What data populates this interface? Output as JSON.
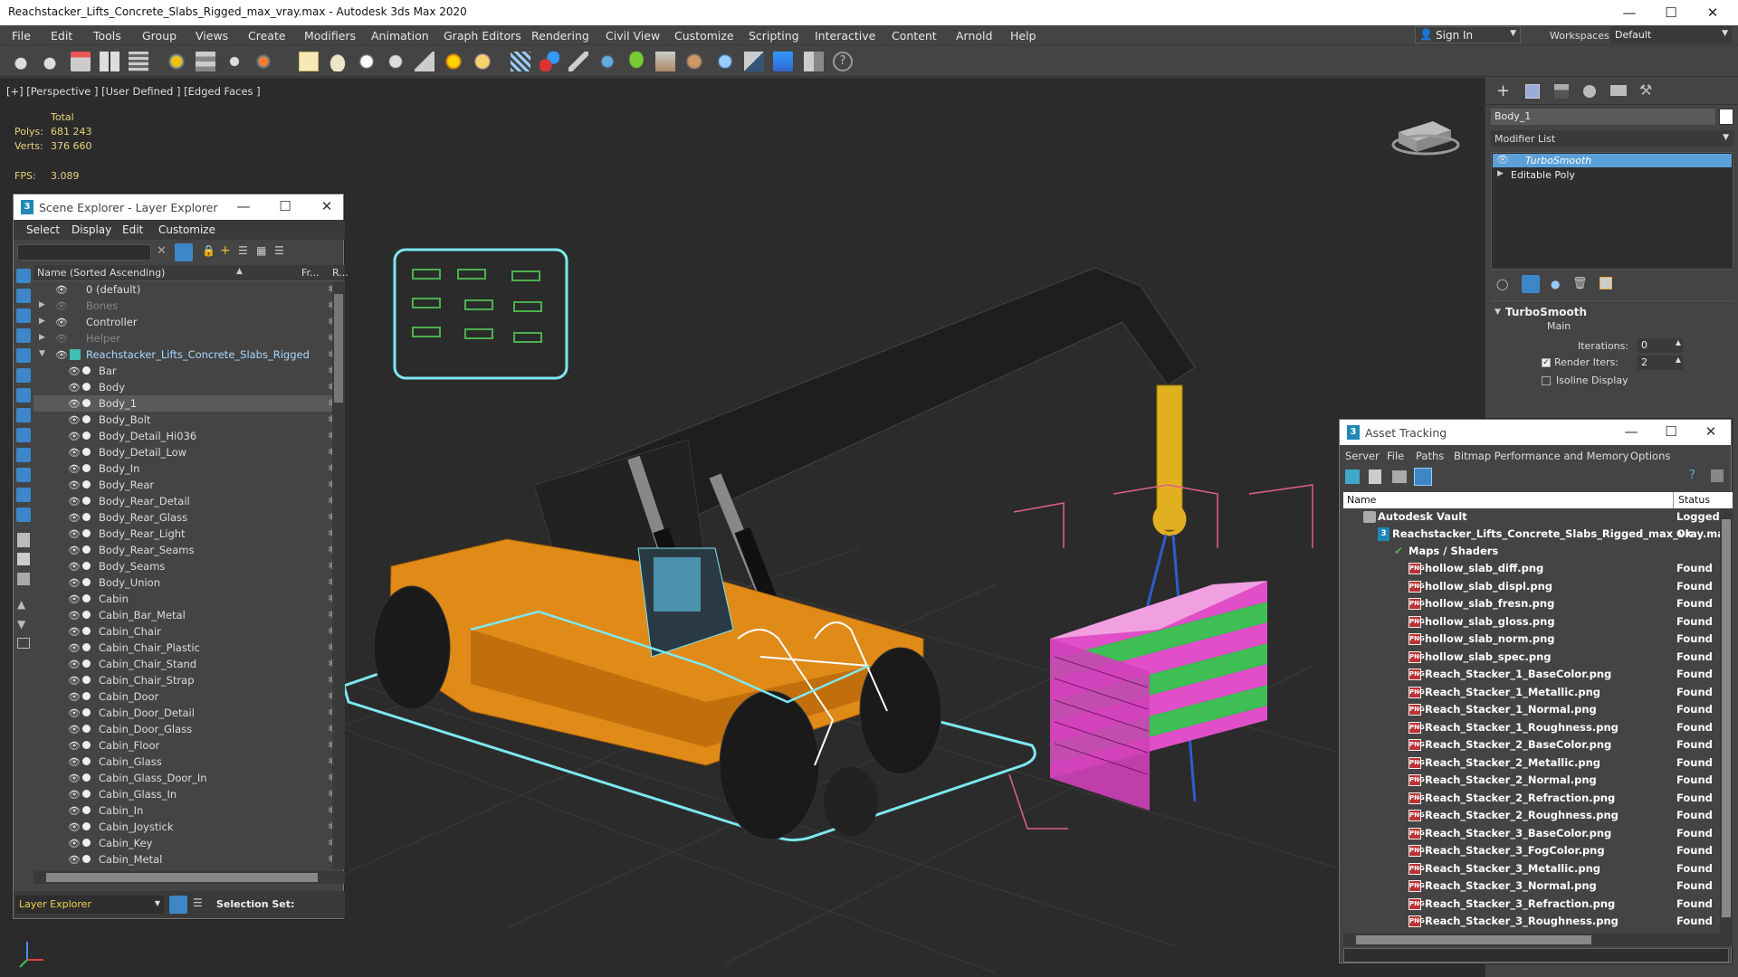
{
  "app": {
    "title": "Reachstacker_Lifts_Concrete_Slabs_Rigged_max_vray.max - Autodesk 3ds Max 2020"
  },
  "menu": [
    "File",
    "Edit",
    "Tools",
    "Group",
    "Views",
    "Create",
    "Modifiers",
    "Animation",
    "Graph Editors",
    "Rendering",
    "Civil View",
    "Customize",
    "Scripting",
    "Interactive",
    "Content",
    "Arnold",
    "Help"
  ],
  "signin": {
    "label": "Sign In",
    "workspaces_label": "Workspaces:",
    "workspace": "Default"
  },
  "viewport": {
    "label": "[+] [Perspective ] [User Defined ] [Edged Faces ]",
    "stats": {
      "total_label": "Total",
      "polys_label": "Polys:",
      "polys": "681 243",
      "verts_label": "Verts:",
      "verts": "376 660",
      "fps_label": "FPS:",
      "fps": "3.089"
    }
  },
  "command_panel": {
    "object_name": "Body_1",
    "modifier_list": "Modifier List",
    "stack": [
      "TurboSmooth",
      "Editable Poly"
    ],
    "rollout_title": "TurboSmooth",
    "main_label": "Main",
    "iterations_label": "Iterations:",
    "iterations": "0",
    "render_iters_label": "Render Iters:",
    "render_iters": "2",
    "isoline_label": "Isoline Display"
  },
  "scene_explorer": {
    "title": "Scene Explorer - Layer Explorer",
    "menu": [
      "Select",
      "Display",
      "Edit",
      "Customize"
    ],
    "col_name": "Name (Sorted Ascending)",
    "col_fr": "Fr...",
    "col_r": "R...",
    "layers": [
      "0 (default)",
      "Bones",
      "Controller",
      "Helper",
      "Reachstacker_Lifts_Concrete_Slabs_Rigged"
    ],
    "objects": [
      "Bar",
      "Body",
      "Body_1",
      "Body_Bolt",
      "Body_Detail_Hi036",
      "Body_Detail_Low",
      "Body_In",
      "Body_Rear",
      "Body_Rear_Detail",
      "Body_Rear_Glass",
      "Body_Rear_Light",
      "Body_Rear_Seams",
      "Body_Seams",
      "Body_Union",
      "Cabin",
      "Cabin_Bar_Metal",
      "Cabin_Chair",
      "Cabin_Chair_Plastic",
      "Cabin_Chair_Stand",
      "Cabin_Chair_Strap",
      "Cabin_Door",
      "Cabin_Door_Detail",
      "Cabin_Door_Glass",
      "Cabin_Floor",
      "Cabin_Glass",
      "Cabin_Glass_Door_In",
      "Cabin_Glass_In",
      "Cabin_In",
      "Cabin_Joystick",
      "Cabin_Key",
      "Cabin_Metal"
    ],
    "footer_mode": "Layer Explorer",
    "selection_set_label": "Selection Set:"
  },
  "asset_tracking": {
    "title": "Asset Tracking",
    "menu": [
      "Server",
      "File",
      "Paths",
      "Bitmap Performance and Memory",
      "Options"
    ],
    "col_name": "Name",
    "col_status": "Status",
    "vault": {
      "name": "Autodesk Vault",
      "status": "Logged"
    },
    "file": {
      "name": "Reachstacker_Lifts_Concrete_Slabs_Rigged_max_vray.max",
      "status": "Ok"
    },
    "maps_label": "Maps / Shaders",
    "maps": [
      {
        "name": "hollow_slab_diff.png",
        "status": "Found"
      },
      {
        "name": "hollow_slab_displ.png",
        "status": "Found"
      },
      {
        "name": "hollow_slab_fresn.png",
        "status": "Found"
      },
      {
        "name": "hollow_slab_gloss.png",
        "status": "Found"
      },
      {
        "name": "hollow_slab_norm.png",
        "status": "Found"
      },
      {
        "name": "hollow_slab_spec.png",
        "status": "Found"
      },
      {
        "name": "Reach_Stacker_1_BaseColor.png",
        "status": "Found"
      },
      {
        "name": "Reach_Stacker_1_Metallic.png",
        "status": "Found"
      },
      {
        "name": "Reach_Stacker_1_Normal.png",
        "status": "Found"
      },
      {
        "name": "Reach_Stacker_1_Roughness.png",
        "status": "Found"
      },
      {
        "name": "Reach_Stacker_2_BaseColor.png",
        "status": "Found"
      },
      {
        "name": "Reach_Stacker_2_Metallic.png",
        "status": "Found"
      },
      {
        "name": "Reach_Stacker_2_Normal.png",
        "status": "Found"
      },
      {
        "name": "Reach_Stacker_2_Refraction.png",
        "status": "Found"
      },
      {
        "name": "Reach_Stacker_2_Roughness.png",
        "status": "Found"
      },
      {
        "name": "Reach_Stacker_3_BaseColor.png",
        "status": "Found"
      },
      {
        "name": "Reach_Stacker_3_FogColor.png",
        "status": "Found"
      },
      {
        "name": "Reach_Stacker_3_Metallic.png",
        "status": "Found"
      },
      {
        "name": "Reach_Stacker_3_Normal.png",
        "status": "Found"
      },
      {
        "name": "Reach_Stacker_3_Refraction.png",
        "status": "Found"
      },
      {
        "name": "Reach_Stacker_3_Roughness.png",
        "status": "Found"
      }
    ]
  },
  "colors": {
    "accent": "#3d87c8",
    "selection": "#5ba0d8",
    "vehicle": "#e08a18",
    "wire": "#7de8f0",
    "slab_pink": "#e04fc8",
    "slab_green": "#3fbf55"
  }
}
